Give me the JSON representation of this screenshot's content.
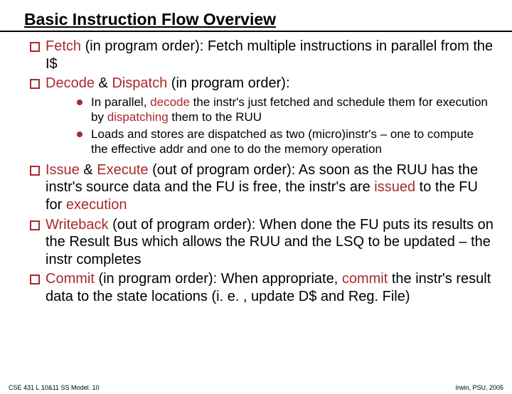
{
  "title": "Basic Instruction Flow Overview",
  "items": [
    {
      "segs": [
        {
          "t": "Fetch ",
          "k": true
        },
        {
          "t": "(in program order):  Fetch multiple instructions in parallel from the I$",
          "k": false
        }
      ]
    },
    {
      "segs": [
        {
          "t": "Decode ",
          "k": true
        },
        {
          "t": "& ",
          "k": false
        },
        {
          "t": "Dispatch ",
          "k": true
        },
        {
          "t": "(in program order):",
          "k": false
        }
      ],
      "sub": [
        {
          "segs": [
            {
              "t": "In parallel, ",
              "k": false
            },
            {
              "t": "decode",
              "k": true
            },
            {
              "t": " the instr's just fetched and schedule them for execution by ",
              "k": false
            },
            {
              "t": "dispatching",
              "k": true
            },
            {
              "t": " them to the RUU",
              "k": false
            }
          ]
        },
        {
          "segs": [
            {
              "t": "Loads and stores are dispatched as two (micro)instr's – one to compute the effective addr and one to do the memory operation",
              "k": false
            }
          ]
        }
      ]
    },
    {
      "segs": [
        {
          "t": "Issue ",
          "k": true
        },
        {
          "t": "& ",
          "k": false
        },
        {
          "t": "Execute ",
          "k": true
        },
        {
          "t": "(out of program order): As soon as the RUU has the instr's source data and the FU is free, the instr's are ",
          "k": false
        },
        {
          "t": "issued",
          "k": true
        },
        {
          "t": " to the FU for ",
          "k": false
        },
        {
          "t": "execution",
          "k": true
        }
      ]
    },
    {
      "segs": [
        {
          "t": "Writeback ",
          "k": true
        },
        {
          "t": "(out of program order): When done the FU puts its results on the Result Bus which allows the RUU and the LSQ to be updated – the instr completes",
          "k": false
        }
      ]
    },
    {
      "segs": [
        {
          "t": "Commit ",
          "k": true
        },
        {
          "t": "(in program order): When appropriate, ",
          "k": false
        },
        {
          "t": "commit",
          "k": true
        },
        {
          "t": " the instr's result data to the state locations (i. e. , update D$ and Reg. File)",
          "k": false
        }
      ]
    }
  ],
  "footer_left": "CSE 431  L 10&11 SS Model. 10",
  "footer_right": "Irwin, PSU, 2005"
}
